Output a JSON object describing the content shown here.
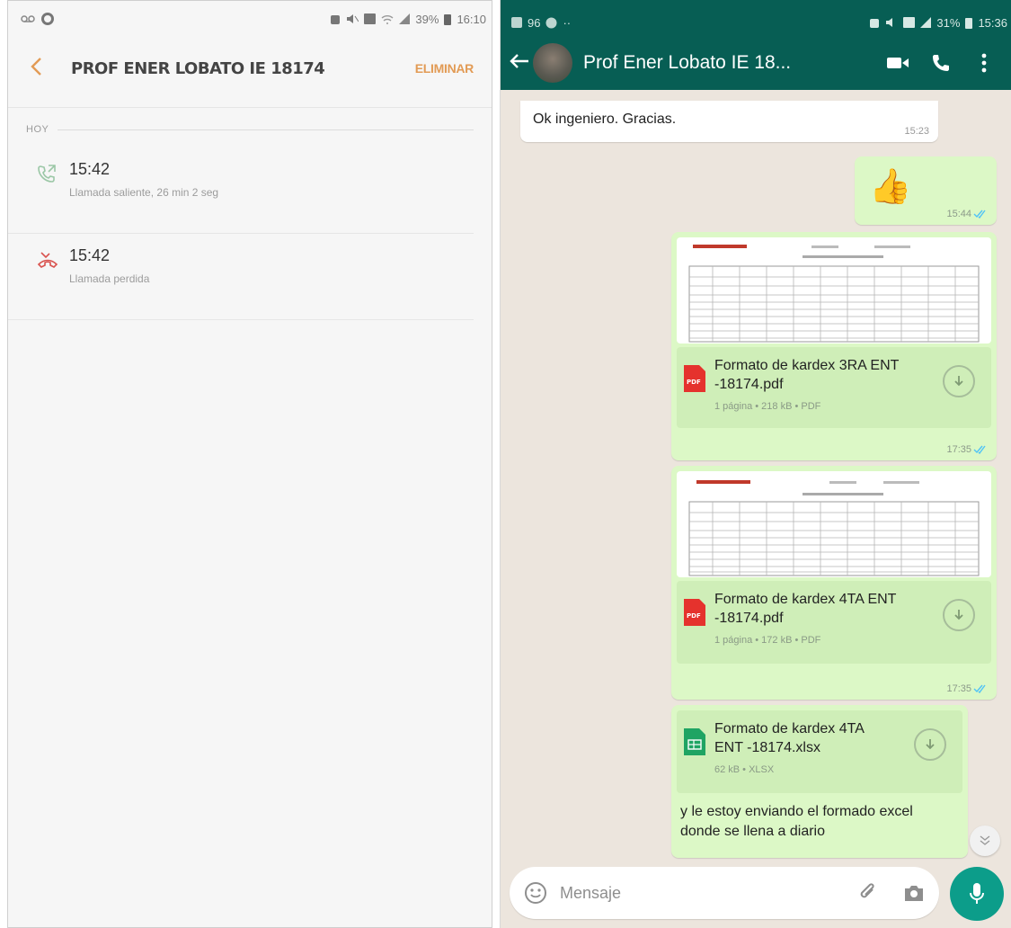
{
  "left": {
    "status_time": "16:10",
    "status_battery": "39%",
    "contact_title": "PROF ENER LOBATO IE 18174",
    "delete_label": "ELIMINAR",
    "section_label": "HOY",
    "calls": [
      {
        "time": "15:42",
        "description": "Llamada saliente, 26 min 2 seg",
        "icon": "outgoing-call-icon"
      },
      {
        "time": "15:42",
        "description": "Llamada perdida",
        "icon": "missed-call-icon"
      }
    ],
    "colors": {
      "accent": "#e29b55",
      "missed": "#d9534f",
      "outgoing": "#7fb68f"
    }
  },
  "right": {
    "status_left": "96",
    "status_time": "15:36",
    "status_battery": "31%",
    "chat_name": "Prof Ener Lobato IE 18...",
    "messages": {
      "m1": {
        "text": "Ok ingeniero. Gracias.",
        "time": "15:23"
      },
      "m2": {
        "emoji": "👍",
        "time": "15:44"
      },
      "m3": {
        "title": "Formato de kardex 3RA ENT -18174.pdf",
        "meta": "1 página • 218 kB • PDF",
        "time": "17:35",
        "file_label": "PDF"
      },
      "m4": {
        "title": "Formato de kardex 4TA ENT -18174.pdf",
        "meta": "1 página • 172 kB • PDF",
        "time": "17:35",
        "file_label": "PDF"
      },
      "m5": {
        "title": "Formato de kardex 4TA ENT -18174.xlsx",
        "meta": "62 kB • XLSX",
        "text": "y le estoy enviando el formado excel donde se llena a diario"
      }
    },
    "composer_placeholder": "Mensaje",
    "colors": {
      "header": "#075e54",
      "outgoing_bubble": "#dcf8c6",
      "mic": "#0c9d8a",
      "ticks": "#4fc3f7"
    }
  }
}
